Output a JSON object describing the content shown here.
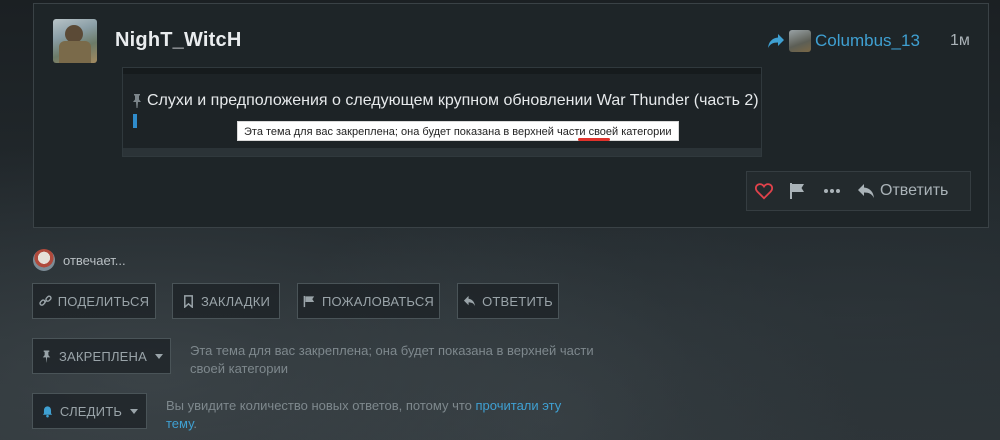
{
  "post": {
    "username": "NighT_WitcH",
    "reply_to_user": "Columbus_13",
    "age": "1м",
    "embed": {
      "topic_title": "Слухи и предположения о следующем крупном обновлении War Thunder (часть 2)",
      "tooltip": "Эта тема для вас закреплена; она будет показана в верхней части своей категории"
    },
    "actions": {
      "reply_label": "Ответить"
    }
  },
  "replying": {
    "text": "отвечает..."
  },
  "footer": {
    "share": "Поделиться",
    "bookmarks": "Закладки",
    "report": "Пожаловаться",
    "reply": "Ответить",
    "pinned": "Закреплена",
    "pinned_desc": "Эта тема для вас закреплена; она будет показана в верхней части своей категории",
    "watch": "Следить",
    "watch_desc_prefix": "Вы увидите количество новых ответов, потому что ",
    "watch_desc_link": "прочитали эту тему",
    "watch_desc_suffix": "."
  },
  "colors": {
    "link": "#3fa0d2",
    "heart": "#e0424b"
  },
  "icons": [
    "share-arrow-icon",
    "pin-icon",
    "link-icon",
    "bookmark-icon",
    "flag-icon",
    "reply-icon",
    "heart-icon",
    "more-icon",
    "bell-icon"
  ]
}
